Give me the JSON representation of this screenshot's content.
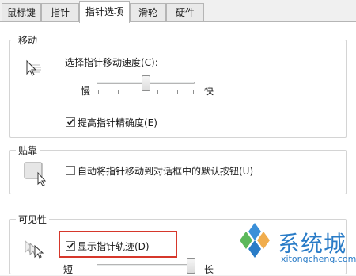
{
  "tabs": [
    "鼠标键",
    "指针",
    "指针选项",
    "滑轮",
    "硬件"
  ],
  "active_tab": "指针选项",
  "motion": {
    "group_title": "移动",
    "speed_label": "选择指针移动速度(C):",
    "slow_label": "慢",
    "fast_label": "快",
    "speed_level": 0.5,
    "precision_label": "提高指针精确度(E)",
    "precision_checked": true
  },
  "snap_to": {
    "group_title": "贴靠",
    "auto_move_label": "自动将指针移动到对话框中的默认按钮(U)",
    "auto_move_checked": false
  },
  "visibility": {
    "group_title": "可见性",
    "trails_label": "显示指针轨迹(D)",
    "trails_checked": true,
    "trails_slow_label": "短",
    "trails_fast_label": "长"
  },
  "watermark": {
    "name": "系统城",
    "url": "xitongcheng.com"
  }
}
